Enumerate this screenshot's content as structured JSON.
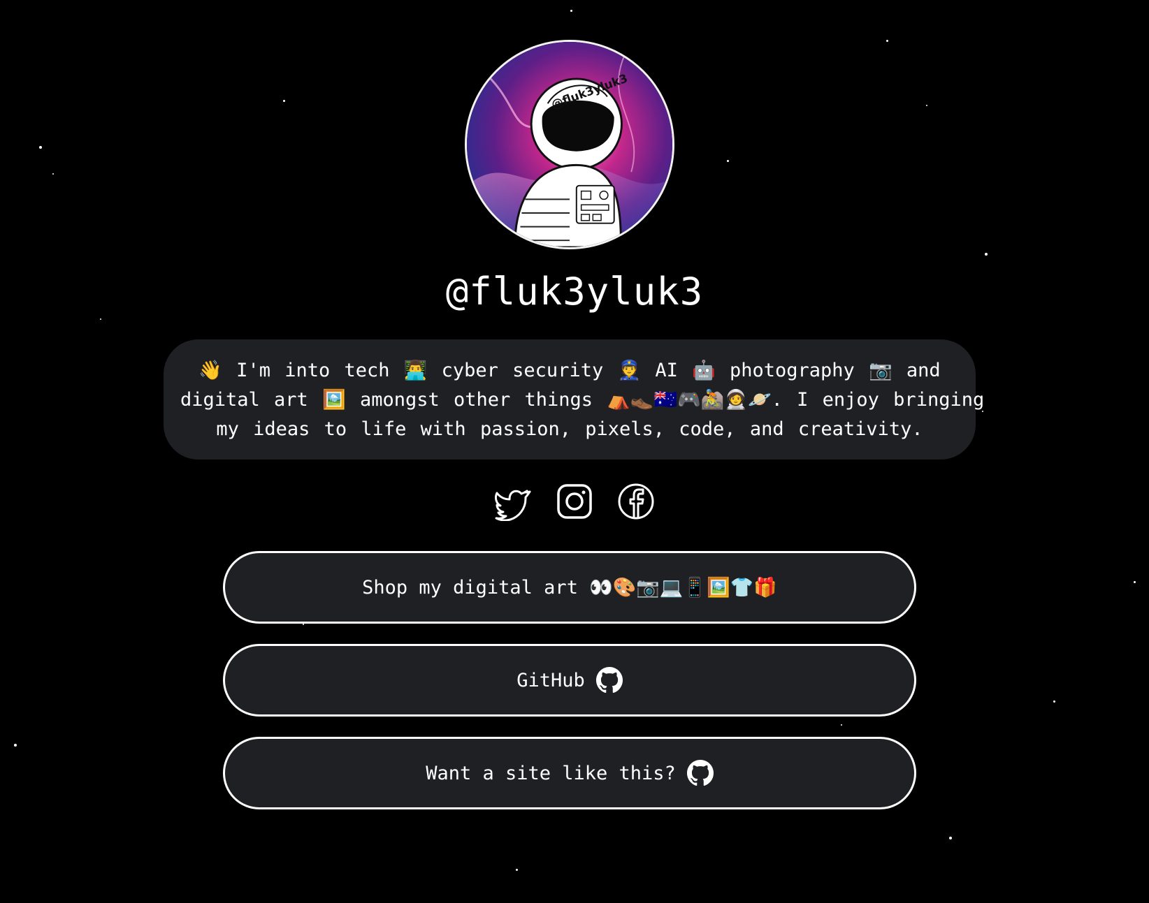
{
  "profile": {
    "handle": "@fluk3yluk3",
    "avatar_icon": "astronaut-avatar",
    "avatar_text": "@fluk3yluk3"
  },
  "bio": {
    "line1": "👋 I'm into tech 👨‍💻 cyber security 👮 AI 🤖 photography 📷 and",
    "line2": "digital art 🖼️ amongst other things ⛺👞🇦🇺🎮🚵🧑‍🚀🪐. I enjoy bringing",
    "line3": "my ideas to life with passion, pixels, code, and creativity."
  },
  "socials": [
    {
      "icon": "twitter-icon"
    },
    {
      "icon": "instagram-icon"
    },
    {
      "icon": "facebook-icon"
    }
  ],
  "links": {
    "shop_label": "Shop my digital art",
    "shop_emoji": "👀🎨📷💻📱🖼️👕🎁",
    "github_label": "GitHub",
    "site_label": "Want a site like this?"
  },
  "colors": {
    "background": "#000000",
    "card": "#1f2024",
    "border": "#ffffff",
    "text": "#ffffff"
  }
}
